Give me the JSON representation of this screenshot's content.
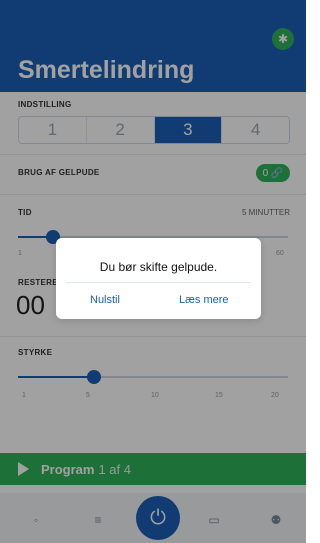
{
  "header": {
    "title": "Smertelindring",
    "bluetooth_glyph": "✱"
  },
  "settings": {
    "indstilling_label": "INDSTILLING",
    "segments": [
      "1",
      "2",
      "3",
      "4"
    ],
    "selected_index": 2,
    "gel_label": "BRUG AF GELPUDE",
    "gel_toggle_value": "0 🔗",
    "tid_label": "TID",
    "tid_value": "5 MINUTTER",
    "tid_ticks": [
      "1",
      "",
      "",
      "",
      "",
      "",
      "",
      "",
      "",
      "",
      "",
      "",
      "",
      "",
      "",
      "",
      "",
      "",
      "",
      "60"
    ],
    "tid_slider_fraction": 0.13,
    "resterende_label": "RESTERENDE",
    "time_remaining": "00",
    "styrke_label": "STYRKE",
    "styrke_value": "",
    "styrke_ticks": [
      "1",
      "5",
      "10",
      "15",
      "20"
    ],
    "styrke_slider_fraction": 0.28
  },
  "program": {
    "label": "Program",
    "sub": "1 af 4"
  },
  "tabbar": {
    "power_glyph": "⏻"
  },
  "dialog": {
    "message": "Du bør skifte gelpude.",
    "left_button": "Nulstil",
    "right_button": "Læs mere"
  },
  "colors": {
    "primary": "#1b5fb6",
    "success": "#2fb45a"
  }
}
